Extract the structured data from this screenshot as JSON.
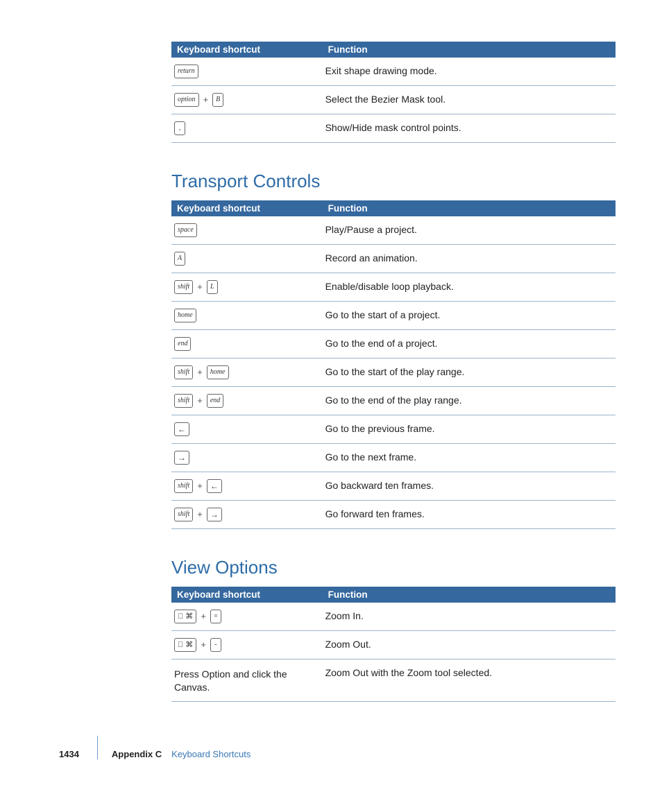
{
  "table1": {
    "head_col1": "Keyboard shortcut",
    "head_col2": "Function",
    "rows": [
      {
        "keys": [
          {
            "t": "key",
            "v": "return"
          }
        ],
        "fn": "Exit shape drawing mode."
      },
      {
        "keys": [
          {
            "t": "key",
            "v": "option"
          },
          {
            "t": "plus"
          },
          {
            "t": "letter",
            "v": "B"
          }
        ],
        "fn": "Select the Bezier Mask tool."
      },
      {
        "keys": [
          {
            "t": "letter",
            "v": ","
          }
        ],
        "fn": "Show/Hide mask control points."
      }
    ]
  },
  "heading_transport": "Transport Controls",
  "table2": {
    "head_col1": "Keyboard shortcut",
    "head_col2": "Function",
    "rows": [
      {
        "keys": [
          {
            "t": "key",
            "v": "space"
          }
        ],
        "fn": "Play/Pause a project."
      },
      {
        "keys": [
          {
            "t": "letter",
            "v": "A"
          }
        ],
        "fn": "Record an animation."
      },
      {
        "keys": [
          {
            "t": "key",
            "v": "shift"
          },
          {
            "t": "plus"
          },
          {
            "t": "letter",
            "v": "L"
          }
        ],
        "fn": "Enable/disable loop playback."
      },
      {
        "keys": [
          {
            "t": "key",
            "v": "home"
          }
        ],
        "fn": "Go to the start of a project."
      },
      {
        "keys": [
          {
            "t": "key",
            "v": "end"
          }
        ],
        "fn": "Go to the end of a project."
      },
      {
        "keys": [
          {
            "t": "key",
            "v": "shift"
          },
          {
            "t": "plus"
          },
          {
            "t": "key",
            "v": "home"
          }
        ],
        "fn": "Go to the start of the play range."
      },
      {
        "keys": [
          {
            "t": "key",
            "v": "shift"
          },
          {
            "t": "plus"
          },
          {
            "t": "key",
            "v": "end"
          }
        ],
        "fn": "Go to the end of the play range."
      },
      {
        "keys": [
          {
            "t": "arrow",
            "v": "←"
          }
        ],
        "fn": "Go to the previous frame."
      },
      {
        "keys": [
          {
            "t": "arrow",
            "v": "→"
          }
        ],
        "fn": "Go to the next frame."
      },
      {
        "keys": [
          {
            "t": "key",
            "v": "shift"
          },
          {
            "t": "plus"
          },
          {
            "t": "arrow",
            "v": "←"
          }
        ],
        "fn": "Go backward ten frames."
      },
      {
        "keys": [
          {
            "t": "key",
            "v": "shift"
          },
          {
            "t": "plus"
          },
          {
            "t": "arrow",
            "v": "→"
          }
        ],
        "fn": "Go forward ten frames."
      }
    ]
  },
  "heading_view": "View Options",
  "table3": {
    "head_col1": "Keyboard shortcut",
    "head_col2": "Function",
    "rows": [
      {
        "keys": [
          {
            "t": "cmd"
          },
          {
            "t": "plus"
          },
          {
            "t": "letter",
            "v": "="
          }
        ],
        "fn": "Zoom In."
      },
      {
        "keys": [
          {
            "t": "cmd"
          },
          {
            "t": "plus"
          },
          {
            "t": "letter",
            "v": "-"
          }
        ],
        "fn": "Zoom Out."
      },
      {
        "text": "Press Option and click the Canvas.",
        "fn": "Zoom Out with the Zoom tool selected."
      }
    ]
  },
  "footer": {
    "page_number": "1434",
    "appendix_label": "Appendix C",
    "appendix_title": "Keyboard Shortcuts"
  }
}
